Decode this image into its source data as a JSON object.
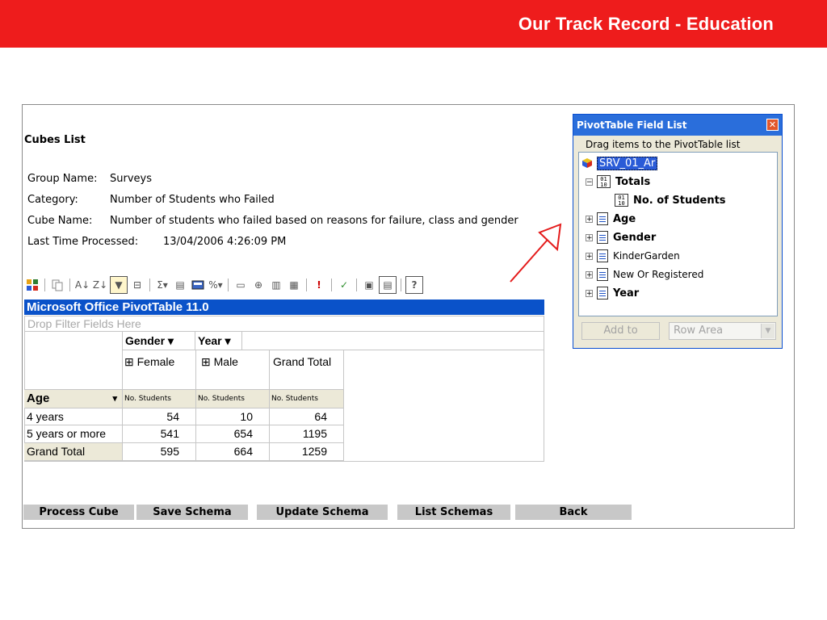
{
  "slide": {
    "title": "Our Track Record - Education"
  },
  "cubes": {
    "title": "Cubes List",
    "group_label": "Group Name:",
    "group_value": "Surveys",
    "category_label": "Category:",
    "category_value": "Number of Students who Failed",
    "cube_label": "Cube Name:",
    "cube_value": "Number of students who failed based on reasons for failure, class and gender",
    "processed_label": "Last Time Processed:",
    "processed_value": "13/04/2006 4:26:09 PM"
  },
  "pivot": {
    "title": "Microsoft Office PivotTable 11.0",
    "drop_filter": "Drop Filter Fields Here",
    "col_field_gender": "Gender ▾",
    "col_field_year": "Year ▾",
    "columns": [
      "⊞ Female",
      "⊞ Male",
      "Grand Total"
    ],
    "row_field": "Age",
    "row_field_arrow": "▾",
    "measure_labels": [
      "No. Students",
      "No. Students",
      "No. Students"
    ],
    "rows": [
      {
        "label": "4 years",
        "values": [
          "54",
          "10",
          "64"
        ]
      },
      {
        "label": "5 years or more",
        "values": [
          "541",
          "654",
          "1195"
        ]
      },
      {
        "label": "Grand Total",
        "values": [
          "595",
          "664",
          "1259"
        ]
      }
    ]
  },
  "actions": {
    "process": "Process Cube",
    "save": "Save Schema",
    "update": "Update Schema",
    "list": "List Schemas",
    "back": "Back"
  },
  "field_list": {
    "title": "PivotTable Field List",
    "close": "✕",
    "hint": "Drag items to the PivotTable list",
    "cube": "SRV_01_Ar",
    "totals": "Totals",
    "measure": "No. of Students",
    "fields": [
      "Age",
      "Gender",
      "KinderGarden",
      "New Or Registered",
      "Year"
    ],
    "add_to": "Add to",
    "area": "Row Area"
  },
  "colors": {
    "banner": "#ee1c1c",
    "pivot_title": "#0a52c9",
    "arrow": "#e41b1b"
  },
  "icons": [
    "cube-icon",
    "expand-icon",
    "collapse-icon",
    "field-icon",
    "measure-icon",
    "close-icon",
    "dropdown-arrow-icon"
  ]
}
